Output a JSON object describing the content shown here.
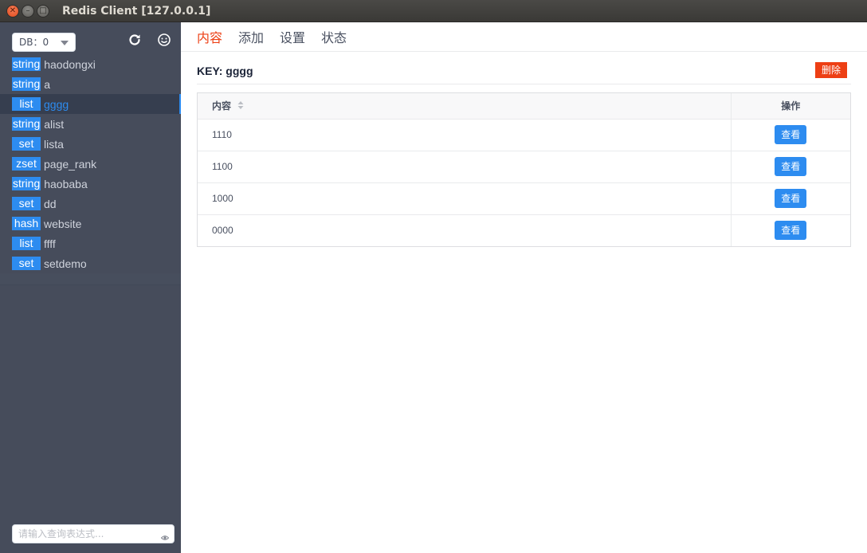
{
  "window": {
    "title": "Redis Client [127.0.0.1]",
    "close_glyph": "✕",
    "min_glyph": "–",
    "max_glyph": "□"
  },
  "sidebar": {
    "db_select": "DB：0",
    "refresh_icon": "refresh-icon",
    "info_icon": "smiley-icon",
    "keys": [
      {
        "type": "string",
        "name": "haodongxi"
      },
      {
        "type": "string",
        "name": "a"
      },
      {
        "type": "list",
        "name": "gggg"
      },
      {
        "type": "string",
        "name": "alist"
      },
      {
        "type": "set",
        "name": "lista"
      },
      {
        "type": "zset",
        "name": "page_rank"
      },
      {
        "type": "string",
        "name": "haobaba"
      },
      {
        "type": "set",
        "name": "dd"
      },
      {
        "type": "hash",
        "name": "website"
      },
      {
        "type": "list",
        "name": "ffff"
      },
      {
        "type": "set",
        "name": "setdemo"
      }
    ],
    "search_placeholder": "请输入查询表达式..."
  },
  "tabs": [
    {
      "label": "内容"
    },
    {
      "label": "添加"
    },
    {
      "label": "设置"
    },
    {
      "label": "状态"
    }
  ],
  "key_header": {
    "label": "KEY: gggg",
    "delete_label": "删除"
  },
  "table": {
    "col_content": "内容",
    "col_op": "操作",
    "rows": [
      {
        "value": "1110",
        "action": "查看"
      },
      {
        "value": "1100",
        "action": "查看"
      },
      {
        "value": "1000",
        "action": "查看"
      },
      {
        "value": "0000",
        "action": "查看"
      }
    ]
  },
  "colors": {
    "accent": "#2d8cf0",
    "danger": "#ed3f14",
    "sidebar_bg": "#464c5b"
  }
}
